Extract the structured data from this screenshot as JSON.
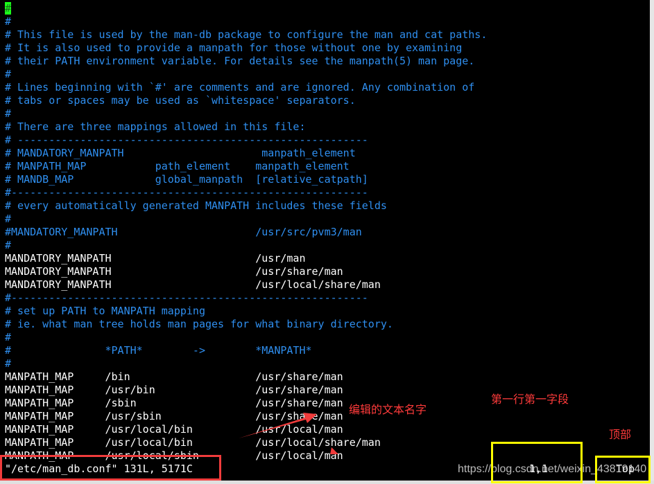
{
  "editor": {
    "lines": [
      {
        "text": "#",
        "kind": "comment",
        "cursor": true
      },
      {
        "text": "#",
        "kind": "comment"
      },
      {
        "text": "# This file is used by the man-db package to configure the man and cat paths.",
        "kind": "comment"
      },
      {
        "text": "# It is also used to provide a manpath for those without one by examining",
        "kind": "comment"
      },
      {
        "text": "# their PATH environment variable. For details see the manpath(5) man page.",
        "kind": "comment"
      },
      {
        "text": "#",
        "kind": "comment"
      },
      {
        "text": "# Lines beginning with `#' are comments and are ignored. Any combination of",
        "kind": "comment"
      },
      {
        "text": "# tabs or spaces may be used as `whitespace' separators.",
        "kind": "comment"
      },
      {
        "text": "#",
        "kind": "comment"
      },
      {
        "text": "# There are three mappings allowed in this file:",
        "kind": "comment"
      },
      {
        "text": "# --------------------------------------------------------",
        "kind": "comment"
      },
      {
        "text": "# MANDATORY_MANPATH                      manpath_element",
        "kind": "comment"
      },
      {
        "text": "# MANPATH_MAP           path_element    manpath_element",
        "kind": "comment"
      },
      {
        "text": "# MANDB_MAP             global_manpath  [relative_catpath]",
        "kind": "comment"
      },
      {
        "text": "#---------------------------------------------------------",
        "kind": "comment"
      },
      {
        "text": "# every automatically generated MANPATH includes these fields",
        "kind": "comment"
      },
      {
        "text": "#",
        "kind": "comment"
      },
      {
        "text": "#MANDATORY_MANPATH                      /usr/src/pvm3/man",
        "kind": "comment"
      },
      {
        "text": "#",
        "kind": "comment"
      },
      {
        "text": "MANDATORY_MANPATH                       /usr/man",
        "kind": "code"
      },
      {
        "text": "MANDATORY_MANPATH                       /usr/share/man",
        "kind": "code"
      },
      {
        "text": "MANDATORY_MANPATH                       /usr/local/share/man",
        "kind": "code"
      },
      {
        "text": "#---------------------------------------------------------",
        "kind": "comment"
      },
      {
        "text": "# set up PATH to MANPATH mapping",
        "kind": "comment"
      },
      {
        "text": "# ie. what man tree holds man pages for what binary directory.",
        "kind": "comment"
      },
      {
        "text": "#",
        "kind": "comment"
      },
      {
        "text": "#               *PATH*        ->        *MANPATH*",
        "kind": "comment"
      },
      {
        "text": "#",
        "kind": "comment"
      },
      {
        "text": "MANPATH_MAP     /bin                    /usr/share/man",
        "kind": "code"
      },
      {
        "text": "MANPATH_MAP     /usr/bin                /usr/share/man",
        "kind": "code"
      },
      {
        "text": "MANPATH_MAP     /sbin                   /usr/share/man",
        "kind": "code"
      },
      {
        "text": "MANPATH_MAP     /usr/sbin               /usr/share/man",
        "kind": "code"
      },
      {
        "text": "MANPATH_MAP     /usr/local/bin          /usr/local/man",
        "kind": "code"
      },
      {
        "text": "MANPATH_MAP     /usr/local/bin          /usr/local/share/man",
        "kind": "code"
      },
      {
        "text": "MANPATH_MAP     /usr/local/sbin         /usr/local/man",
        "kind": "code"
      }
    ],
    "status_message": "\"/etc/man_db.conf\" 131L, 5171C",
    "cursor_position": "1,1",
    "scroll_position": "Top"
  },
  "annotations": {
    "file_name_label": "编辑的文本名字",
    "position_label": "第一行第一字段",
    "top_label": "顶部"
  },
  "watermark": "https://blog.csdn.net/weixin_43819140",
  "colors": {
    "comment": "#2f8ff0",
    "text": "#ffffff",
    "cursor": "#1aff1a",
    "annotation_red": "#f03c3c",
    "annotation_yellow": "#ffff00"
  }
}
